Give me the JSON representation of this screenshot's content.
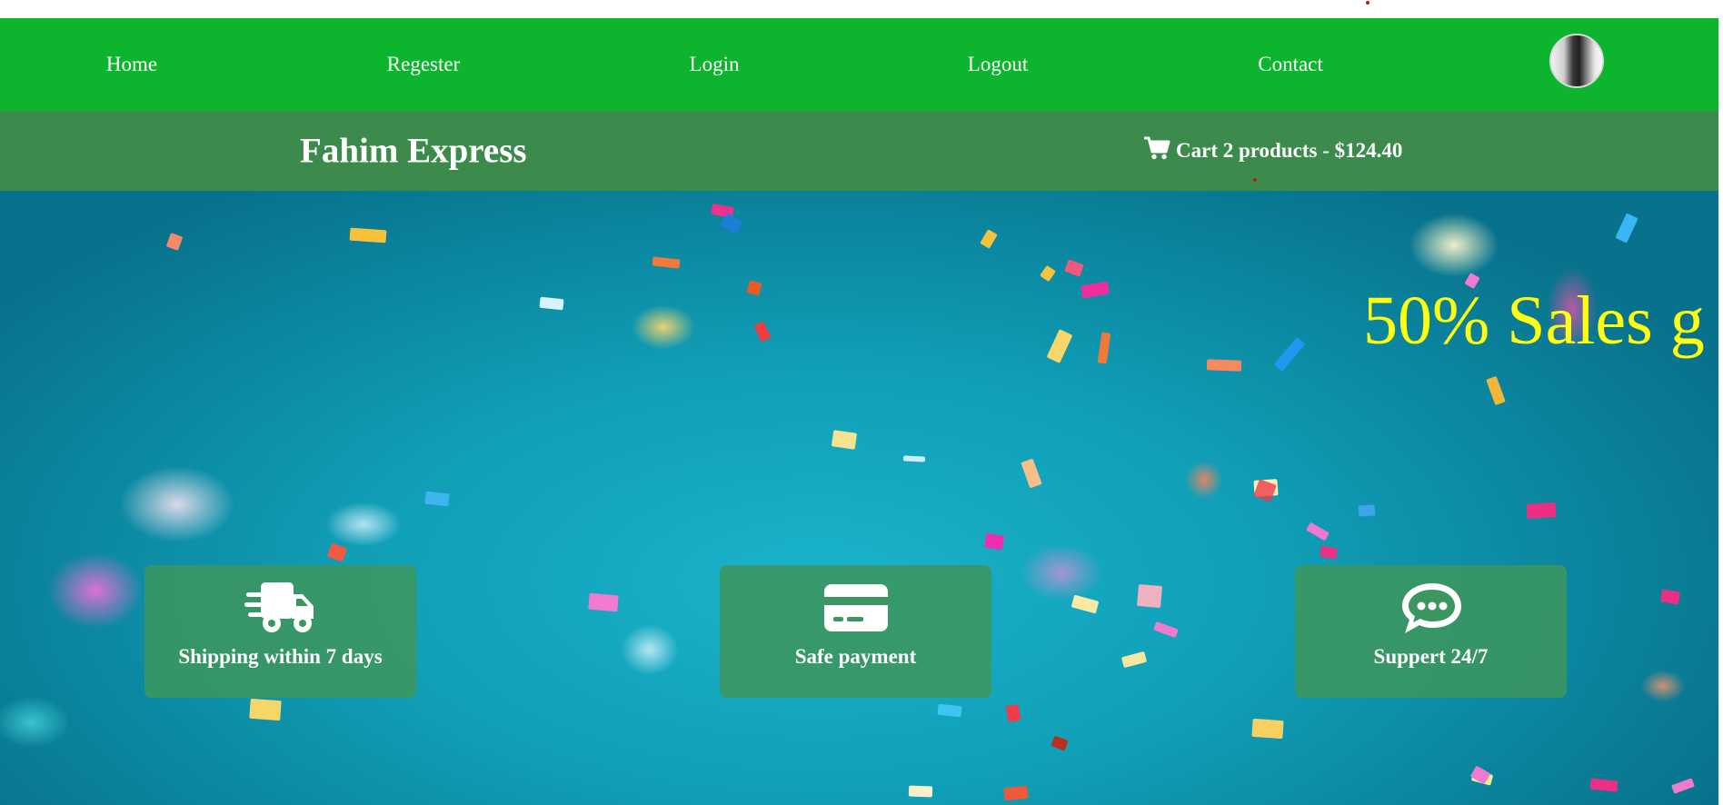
{
  "nav": {
    "items": [
      {
        "label": "Home"
      },
      {
        "label": "Regester"
      },
      {
        "label": "Login"
      },
      {
        "label": "Logout"
      },
      {
        "label": "Contact"
      }
    ],
    "avatar_icon": "user-avatar"
  },
  "header": {
    "brand": "Fahim Express",
    "cart_icon": "shopping-cart-icon",
    "cart_text": "Cart 2 products - $124.40"
  },
  "hero": {
    "promo_text": "50% Sales g"
  },
  "features": [
    {
      "icon": "shipping-truck-icon",
      "label": "Shipping within 7 days"
    },
    {
      "icon": "credit-card-icon",
      "label": "Safe payment"
    },
    {
      "icon": "chat-bubble-icon",
      "label": "Suppert 24/7"
    }
  ],
  "colors": {
    "nav_bg": "#0db52e",
    "brand_bar_bg": "#3c8b4c",
    "hero_bg": "#109fb7",
    "promo_text": "#ffff10",
    "feature_card_bg": "#3c965f"
  }
}
